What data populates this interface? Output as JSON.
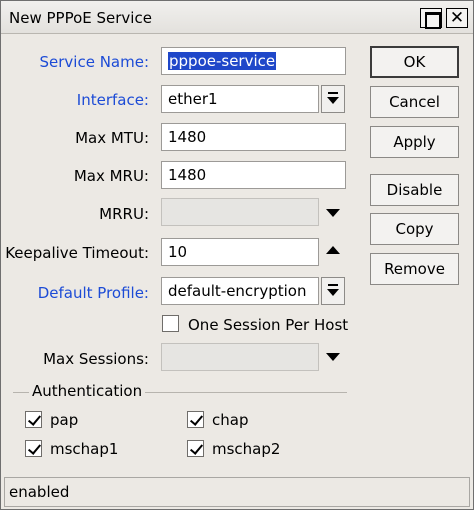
{
  "window": {
    "title": "New PPPoE Service"
  },
  "form": {
    "service_name": {
      "label": "Service Name:",
      "value": "pppoe-service"
    },
    "interface": {
      "label": "Interface:",
      "value": "ether1"
    },
    "max_mtu": {
      "label": "Max MTU:",
      "value": "1480"
    },
    "max_mru": {
      "label": "Max MRU:",
      "value": "1480"
    },
    "mrru": {
      "label": "MRRU:",
      "value": ""
    },
    "keepalive_timeout": {
      "label": "Keepalive Timeout:",
      "value": "10"
    },
    "default_profile": {
      "label": "Default Profile:",
      "value": "default-encryption"
    },
    "one_session_per_host": {
      "label": "One Session Per Host",
      "checked": false
    },
    "max_sessions": {
      "label": "Max Sessions:",
      "value": ""
    }
  },
  "authentication": {
    "title": "Authentication",
    "options": [
      {
        "label": "pap",
        "checked": true
      },
      {
        "label": "chap",
        "checked": true
      },
      {
        "label": "mschap1",
        "checked": true
      },
      {
        "label": "mschap2",
        "checked": true
      }
    ]
  },
  "buttons": {
    "ok": "OK",
    "cancel": "Cancel",
    "apply": "Apply",
    "disable": "Disable",
    "copy": "Copy",
    "remove": "Remove"
  },
  "status": "enabled",
  "colors": {
    "link_label": "#1c4bd6",
    "selection": "#1f47c9"
  }
}
